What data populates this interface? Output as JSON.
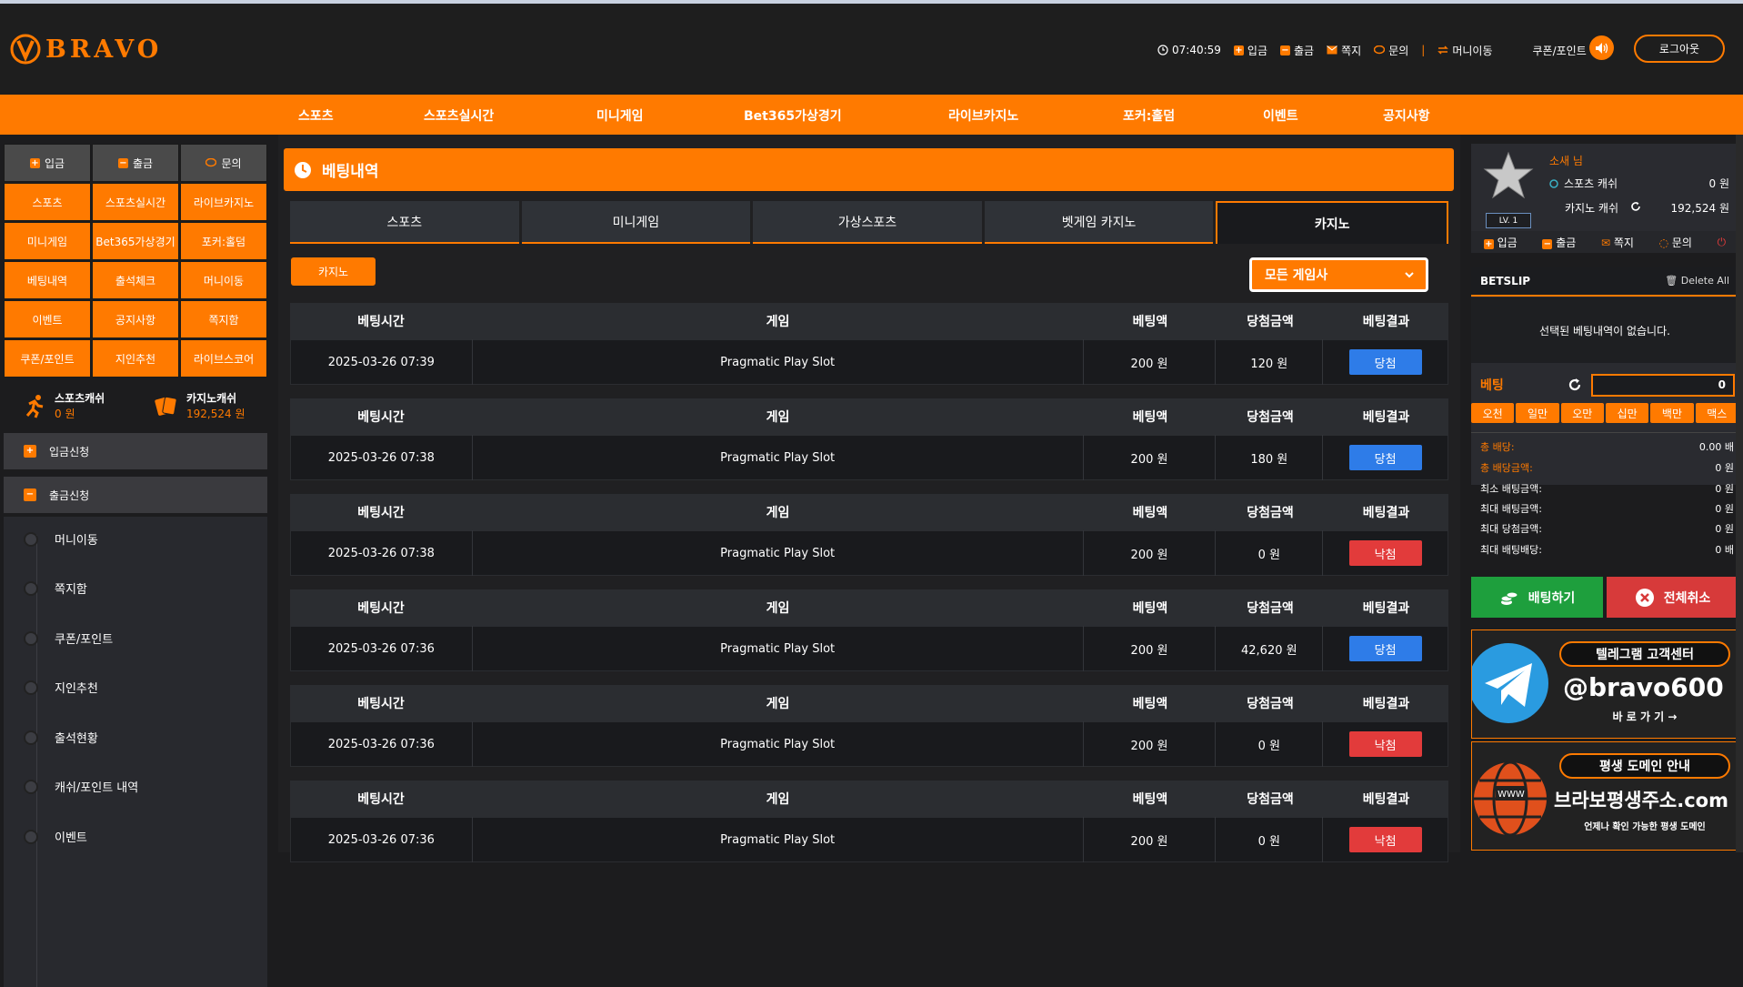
{
  "logo": {
    "text": "BRAVO"
  },
  "header": {
    "time": "07:40:59",
    "links": [
      "입금",
      "출금",
      "쪽지",
      "문의",
      "머니이동"
    ],
    "coupon": "쿠폰/포인트",
    "logout": "로그아웃"
  },
  "nav": [
    "스포츠",
    "스포츠실시간",
    "미니게임",
    "Bet365가상경기",
    "라이브카지노",
    "포커:홀덤",
    "이벤트",
    "공지사항"
  ],
  "left": {
    "quick_top": [
      "입금",
      "출금",
      "문의"
    ],
    "quick_grid": [
      "스포츠",
      "스포츠실시간",
      "라이브카지노",
      "미니게임",
      "Bet365가상경기",
      "포커:홀덤",
      "베팅내역",
      "출석체크",
      "머니이동",
      "이벤트",
      "공지사항",
      "쪽지함",
      "쿠폰/포인트",
      "지인추천",
      "라이브스코어"
    ],
    "sports_cash_label": "스포츠캐쉬",
    "sports_cash_value": "0 원",
    "casino_cash_label": "카지노캐쉬",
    "casino_cash_value": "192,524 원",
    "accordion": [
      "입금신청",
      "출금신청"
    ],
    "submenu": [
      "머니이동",
      "쪽지함",
      "쿠폰/포인트",
      "지인추천",
      "출석현황",
      "캐쉬/포인트 내역",
      "이벤트"
    ]
  },
  "main": {
    "title": "베팅내역",
    "tabs": [
      "스포츠",
      "미니게임",
      "가상스포츠",
      "벳게임 카지노",
      "카지노"
    ],
    "active_tab": 4,
    "category_button": "카지노",
    "provider_select": "모든 게임사",
    "headers": [
      "베팅시간",
      "게임",
      "베팅액",
      "당첨금액",
      "베팅결과"
    ],
    "rows": [
      {
        "time": "2025-03-26 07:39",
        "game": "Pragmatic Play Slot",
        "bet": "200 원",
        "win": "120 원",
        "result": "당첨"
      },
      {
        "time": "2025-03-26 07:38",
        "game": "Pragmatic Play Slot",
        "bet": "200 원",
        "win": "180 원",
        "result": "당첨"
      },
      {
        "time": "2025-03-26 07:38",
        "game": "Pragmatic Play Slot",
        "bet": "200 원",
        "win": "0 원",
        "result": "낙첨"
      },
      {
        "time": "2025-03-26 07:36",
        "game": "Pragmatic Play Slot",
        "bet": "200 원",
        "win": "42,620 원",
        "result": "당첨"
      },
      {
        "time": "2025-03-26 07:36",
        "game": "Pragmatic Play Slot",
        "bet": "200 원",
        "win": "0 원",
        "result": "낙첨"
      },
      {
        "time": "2025-03-26 07:36",
        "game": "Pragmatic Play Slot",
        "bet": "200 원",
        "win": "0 원",
        "result": "낙첨"
      }
    ]
  },
  "right": {
    "user": "소새 님",
    "level": "LV. 1",
    "sports_cash_label": "스포츠 캐쉬",
    "sports_cash_value": "0 원",
    "casino_cash_label": "카지노 캐쉬",
    "casino_cash_value": "192,524 원",
    "links": [
      "입금",
      "출금",
      "쪽지",
      "문의"
    ],
    "betslip_title": "BETSLIP",
    "delete_all": "Delete All",
    "empty_text": "선택된 베팅내역이 없습니다.",
    "bet_label": "베팅",
    "bet_amount": "0",
    "chips": [
      "오천",
      "일만",
      "오만",
      "십만",
      "백만",
      "맥스"
    ],
    "stats": [
      {
        "label": "총 배당:",
        "value": "0.00 배"
      },
      {
        "label": "총 배당금액:",
        "value": "0 원"
      },
      {
        "label": "최소 배팅금액:",
        "value": "0 원"
      },
      {
        "label": "최대 배팅금액:",
        "value": "0 원"
      },
      {
        "label": "최대 당첨금액:",
        "value": "0 원"
      },
      {
        "label": "최대 배팅배당:",
        "value": "0 배"
      }
    ],
    "bet_button": "배팅하기",
    "cancel_button": "전체취소",
    "banner1": {
      "pill": "텔레그램 고객센터",
      "big": "@bravo600",
      "small": "바 로 가 기 →"
    },
    "banner2": {
      "pill": "평생 도메인 안내",
      "big": "브라보평생주소.com",
      "small": "언제나 확인 가능한 평생 도메인"
    }
  },
  "colors": {
    "accent": "#ff7a00",
    "win": "#2e7ce8",
    "lose": "#e23b3b",
    "bet_green": "#1e9f3d"
  }
}
